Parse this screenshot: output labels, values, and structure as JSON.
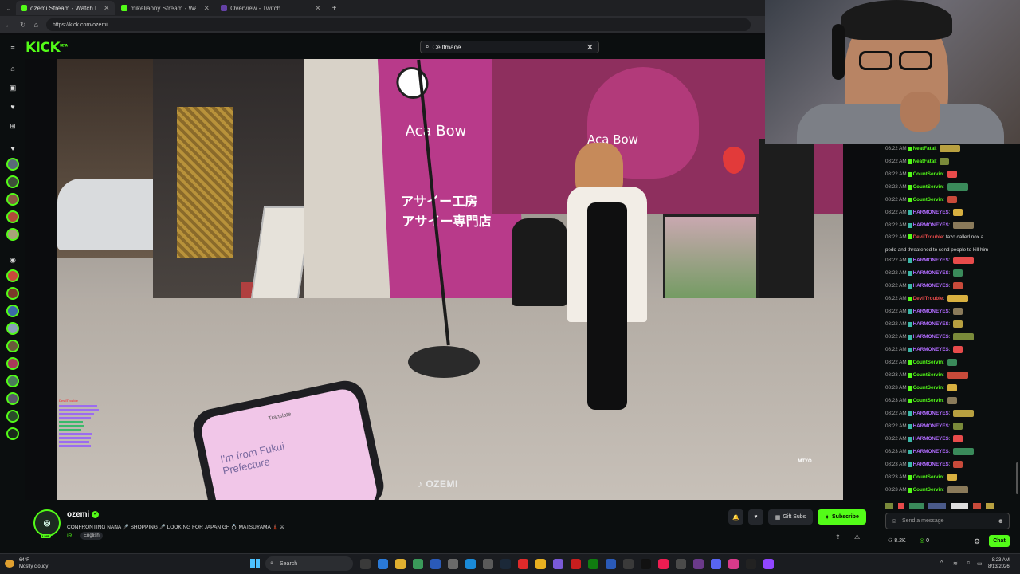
{
  "browser": {
    "tabs": [
      {
        "label": "ozemi Stream - Watch Live on",
        "active": true
      },
      {
        "label": "mikeliaony Stream - Watch Liv",
        "active": false
      },
      {
        "label": "Overview - Twitch",
        "active": false
      }
    ],
    "new_tab": "+",
    "url": "https://kick.com/ozemi"
  },
  "header": {
    "logo": "KICK",
    "logo_super": "BETA",
    "search_value": "Cellfmade"
  },
  "video": {
    "watermark": "OZEMI",
    "signs": [
      "Aca Bow",
      "Aca Bow",
      "アサイー工房",
      "アサイー専門店"
    ],
    "phone_text": [
      "Translate",
      "I'm from Fukui",
      "Prefecture"
    ],
    "overlay_user": "DevilTrouble",
    "corner_logo": "MTYO"
  },
  "chat": {
    "messages": [
      {
        "time": "08:22 AM",
        "user": "NeatFatal",
        "color": "#53fc18",
        "text": ""
      },
      {
        "time": "08:22 AM",
        "user": "NeatFatal",
        "color": "#53fc18",
        "text": ""
      },
      {
        "time": "08:22 AM",
        "user": "CountServin",
        "color": "#53fc18",
        "text": ""
      },
      {
        "time": "08:22 AM",
        "user": "CountServin",
        "color": "#53fc18",
        "text": ""
      },
      {
        "time": "08:22 AM",
        "user": "CountServin",
        "color": "#53fc18",
        "text": ""
      },
      {
        "time": "08:22 AM",
        "user": "HARMONEYES",
        "color": "#b16cff",
        "text": ""
      },
      {
        "time": "08:22 AM",
        "user": "HARMONEYES",
        "color": "#b16cff",
        "text": ""
      },
      {
        "time": "08:22 AM",
        "user": "DevilTrouble",
        "color": "#e84b4b",
        "text": "tazo called nox a"
      },
      {
        "time": "",
        "user": "",
        "color": "#ddd",
        "text": "pedo and threatened to send people to kill him"
      },
      {
        "time": "08:22 AM",
        "user": "HARMONEYES",
        "color": "#b16cff",
        "text": ""
      },
      {
        "time": "08:22 AM",
        "user": "HARMONEYES",
        "color": "#b16cff",
        "text": ""
      },
      {
        "time": "08:22 AM",
        "user": "HARMONEYES",
        "color": "#b16cff",
        "text": ""
      },
      {
        "time": "08:22 AM",
        "user": "DevilTrouble",
        "color": "#e84b4b",
        "text": ""
      },
      {
        "time": "08:22 AM",
        "user": "HARMONEYES",
        "color": "#b16cff",
        "text": ""
      },
      {
        "time": "08:22 AM",
        "user": "HARMONEYES",
        "color": "#b16cff",
        "text": ""
      },
      {
        "time": "08:22 AM",
        "user": "HARMONEYES",
        "color": "#b16cff",
        "text": ""
      },
      {
        "time": "08:22 AM",
        "user": "HARMONEYES",
        "color": "#b16cff",
        "text": ""
      },
      {
        "time": "08:22 AM",
        "user": "CountServin",
        "color": "#53fc18",
        "text": ""
      },
      {
        "time": "08:23 AM",
        "user": "CountServin",
        "color": "#53fc18",
        "text": ""
      },
      {
        "time": "08:23 AM",
        "user": "CountServin",
        "color": "#53fc18",
        "text": ""
      },
      {
        "time": "08:23 AM",
        "user": "CountServin",
        "color": "#53fc18",
        "text": ""
      },
      {
        "time": "08:22 AM",
        "user": "HARMONEYES",
        "color": "#b16cff",
        "text": ""
      },
      {
        "time": "08:22 AM",
        "user": "HARMONEYES",
        "color": "#b16cff",
        "text": ""
      },
      {
        "time": "08:22 AM",
        "user": "HARMONEYES",
        "color": "#b16cff",
        "text": ""
      },
      {
        "time": "08:23 AM",
        "user": "HARMONEYES",
        "color": "#b16cff",
        "text": ""
      },
      {
        "time": "08:23 AM",
        "user": "HARMONEYES",
        "color": "#b16cff",
        "text": ""
      },
      {
        "time": "08:23 AM",
        "user": "CountServin",
        "color": "#53fc18",
        "text": ""
      },
      {
        "time": "08:23 AM",
        "user": "CountServin",
        "color": "#53fc18",
        "text": ""
      }
    ],
    "send_placeholder": "Send a message",
    "viewers": "8.2K",
    "points": "0",
    "chat_button": "Chat"
  },
  "stream": {
    "name": "ozemi",
    "live": "LIVE",
    "title": "CONFRONTING NANA 🎤 SHOPPING 🎤 LOOKING FOR JAPAN GF 💍 MATSUYAMA 🗼 ⚔",
    "category": "IRL",
    "language": "English",
    "gift_label": "Gift Subs",
    "subscribe_label": "Subscribe"
  },
  "taskbar": {
    "weather_temp": "64°F",
    "weather_desc": "Mostly cloudy",
    "search_label": "Search",
    "time": "8:23 AM",
    "date": "8/13/2026"
  },
  "colors": {
    "accent": "#53fc18",
    "bg": "#0b0e0f"
  }
}
